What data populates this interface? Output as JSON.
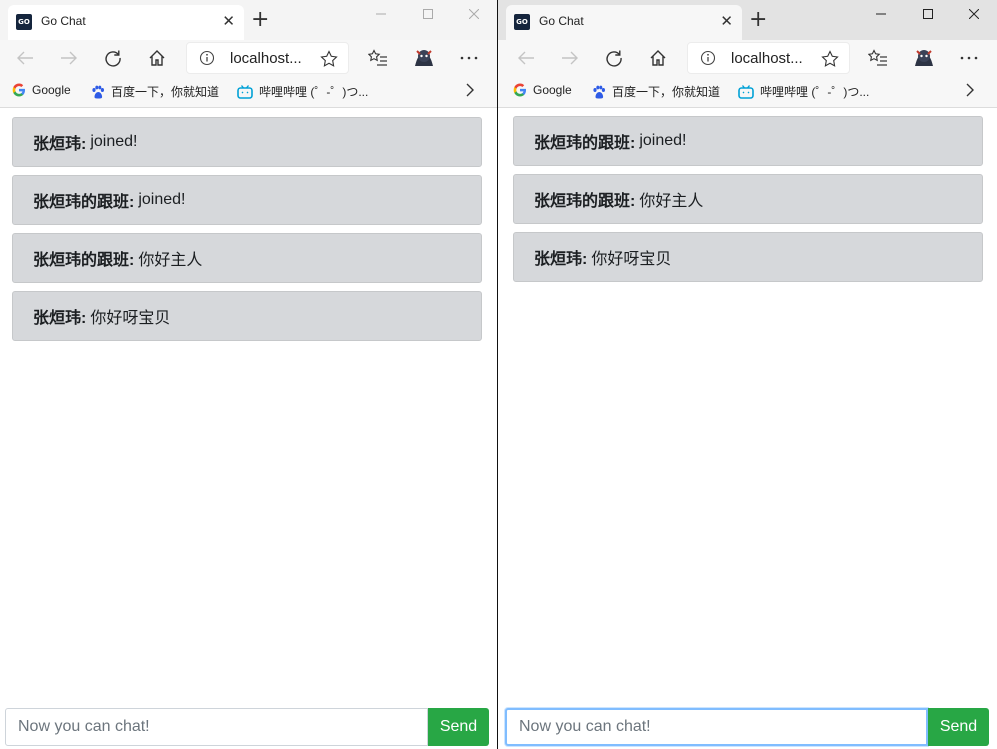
{
  "browser": {
    "tab_title": "Go Chat",
    "tab_favicon_text": "GO",
    "url": "localhost...",
    "bookmarks": [
      {
        "label": "Google",
        "icon": "google-icon"
      },
      {
        "label": "百度一下，你就知道",
        "icon": "baidu-paw-icon"
      },
      {
        "label": "哔哩哔哩 (゜-゜)つ...",
        "icon": "bilibili-tv-icon"
      }
    ]
  },
  "left_window": {
    "messages": [
      {
        "user": "张烜玮:",
        "text": "joined!"
      },
      {
        "user": "张烜玮的跟班:",
        "text": "joined!"
      },
      {
        "user": "张烜玮的跟班:",
        "text": "你好主人"
      },
      {
        "user": "张烜玮:",
        "text": "你好呀宝贝"
      }
    ],
    "input_placeholder": "Now you can chat!",
    "send_label": "Send"
  },
  "right_window": {
    "messages": [
      {
        "user": "张烜玮的跟班:",
        "text": "joined!"
      },
      {
        "user": "张烜玮的跟班:",
        "text": "你好主人"
      },
      {
        "user": "张烜玮:",
        "text": "你好呀宝贝"
      }
    ],
    "input_placeholder": "Now you can chat!",
    "send_label": "Send"
  },
  "colors": {
    "message_bg": "#d6d8db",
    "send_button": "#28a745",
    "input_focus_border": "#80bdff"
  }
}
